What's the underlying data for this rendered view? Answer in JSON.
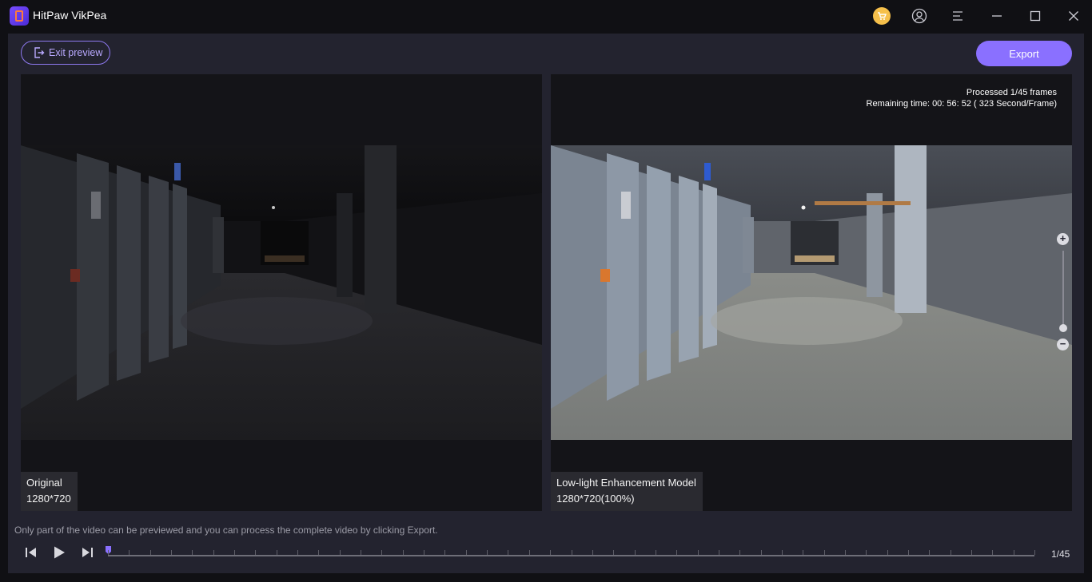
{
  "app": {
    "title": "HitPaw VikPea"
  },
  "toolbar": {
    "exit_label": "Exit preview",
    "export_label": "Export"
  },
  "original": {
    "title": "Original",
    "resolution": "1280*720"
  },
  "enhanced": {
    "title": "Low-light Enhancement Model",
    "resolution": "1280*720(100%)"
  },
  "status": {
    "processed": "Processed 1/45 frames",
    "remaining": "Remaining time: 00: 56: 52 ( 323 Second/Frame)"
  },
  "footer": {
    "hint": "Only part of the video can be previewed and you can process the complete video by clicking Export.",
    "frame_counter": "1/45"
  },
  "playback": {
    "current_frame": 1,
    "total_frames": 45
  },
  "colors": {
    "accent": "#8a70ff",
    "panel": "#23232f",
    "background": "#101014",
    "cart": "#f6c04b"
  },
  "icons": [
    "cart-icon",
    "user-icon",
    "menu-icon",
    "minimize-icon",
    "maximize-icon",
    "close-icon",
    "exit-icon",
    "zoom-in-icon",
    "zoom-out-icon",
    "prev-frame-icon",
    "play-icon",
    "next-frame-icon"
  ]
}
